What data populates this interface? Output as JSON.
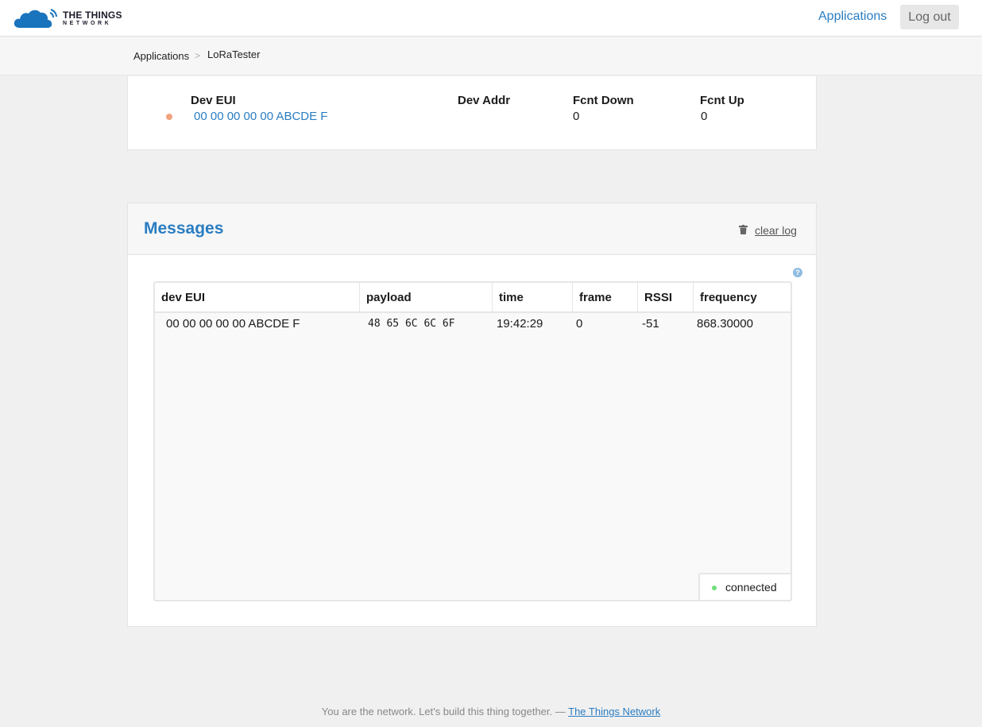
{
  "brand": {
    "line1": "THE THINGS",
    "line2": "NETWORK"
  },
  "nav": {
    "applications": "Applications",
    "logout": "Log out"
  },
  "breadcrumb": {
    "root": "Applications",
    "separator": ">",
    "current": "LoRaTester"
  },
  "device": {
    "headers": {
      "eui": "Dev EUI",
      "addr": "Dev Addr",
      "fcnt_down": "Fcnt Down",
      "fcnt_up": "Fcnt Up"
    },
    "values": {
      "eui": "00 00 00 00 00 ABCDE F",
      "addr": "",
      "fcnt_down": "0",
      "fcnt_up": "0"
    },
    "status_color": "#f2a27e"
  },
  "messages": {
    "title": "Messages",
    "clear_log": "clear log",
    "help": "?",
    "columns": [
      "dev EUI",
      "payload",
      "time",
      "frame",
      "RSSI",
      "frequency"
    ],
    "rows": [
      {
        "dev_eui": "00 00 00 00 00 ABCDE F",
        "payload": "48 65 6C 6C 6F",
        "time": "19:42:29",
        "frame": "0",
        "rssi": "-51",
        "frequency": "868.30000"
      }
    ],
    "connection": {
      "label": "connected",
      "color": "#6fe07a"
    }
  },
  "footer": {
    "text": "You are the network. Let's build this thing together. —",
    "link": "The Things Network"
  },
  "colors": {
    "accent": "#2a7dc2",
    "background": "#f0f0f0"
  }
}
